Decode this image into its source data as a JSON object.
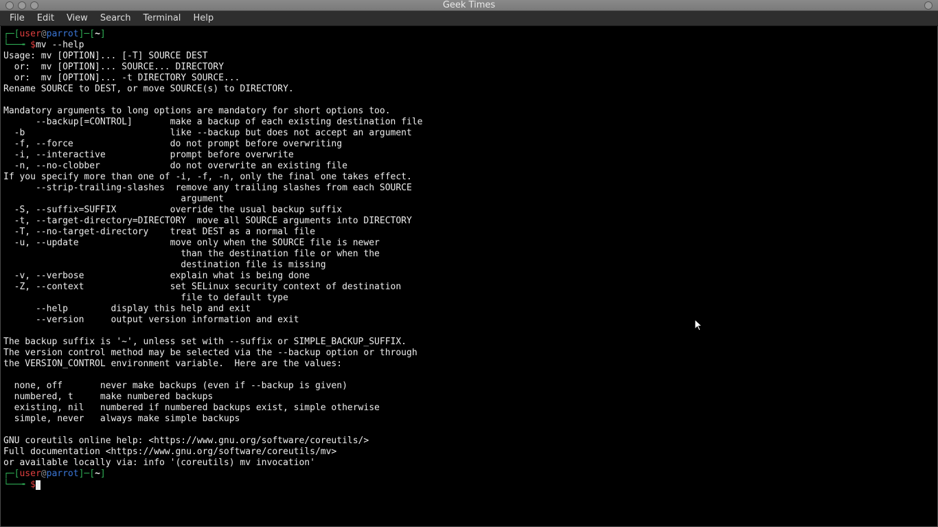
{
  "window": {
    "title": "Geek Times"
  },
  "menubar": [
    "File",
    "Edit",
    "View",
    "Search",
    "Terminal",
    "Help"
  ],
  "prompt": {
    "open": "┌─[",
    "user": "user",
    "at": "@",
    "host": "parrot",
    "close_sep": "]─[",
    "path": "~",
    "close": "]",
    "line2_prefix": "└──╼ ",
    "dollar": "$"
  },
  "cmd1": "mv --help",
  "output": "Usage: mv [OPTION]... [-T] SOURCE DEST\n  or:  mv [OPTION]... SOURCE... DIRECTORY\n  or:  mv [OPTION]... -t DIRECTORY SOURCE...\nRename SOURCE to DEST, or move SOURCE(s) to DIRECTORY.\n\nMandatory arguments to long options are mandatory for short options too.\n      --backup[=CONTROL]       make a backup of each existing destination file\n  -b                           like --backup but does not accept an argument\n  -f, --force                  do not prompt before overwriting\n  -i, --interactive            prompt before overwrite\n  -n, --no-clobber             do not overwrite an existing file\nIf you specify more than one of -i, -f, -n, only the final one takes effect.\n      --strip-trailing-slashes  remove any trailing slashes from each SOURCE\n                                 argument\n  -S, --suffix=SUFFIX          override the usual backup suffix\n  -t, --target-directory=DIRECTORY  move all SOURCE arguments into DIRECTORY\n  -T, --no-target-directory    treat DEST as a normal file\n  -u, --update                 move only when the SOURCE file is newer\n                                 than the destination file or when the\n                                 destination file is missing\n  -v, --verbose                explain what is being done\n  -Z, --context                set SELinux security context of destination\n                                 file to default type\n      --help        display this help and exit\n      --version     output version information and exit\n\nThe backup suffix is '~', unless set with --suffix or SIMPLE_BACKUP_SUFFIX.\nThe version control method may be selected via the --backup option or through\nthe VERSION_CONTROL environment variable.  Here are the values:\n\n  none, off       never make backups (even if --backup is given)\n  numbered, t     make numbered backups\n  existing, nil   numbered if numbered backups exist, simple otherwise\n  simple, never   always make simple backups\n\nGNU coreutils online help: <https://www.gnu.org/software/coreutils/>\nFull documentation <https://www.gnu.org/software/coreutils/mv>\nor available locally via: info '(coreutils) mv invocation'"
}
